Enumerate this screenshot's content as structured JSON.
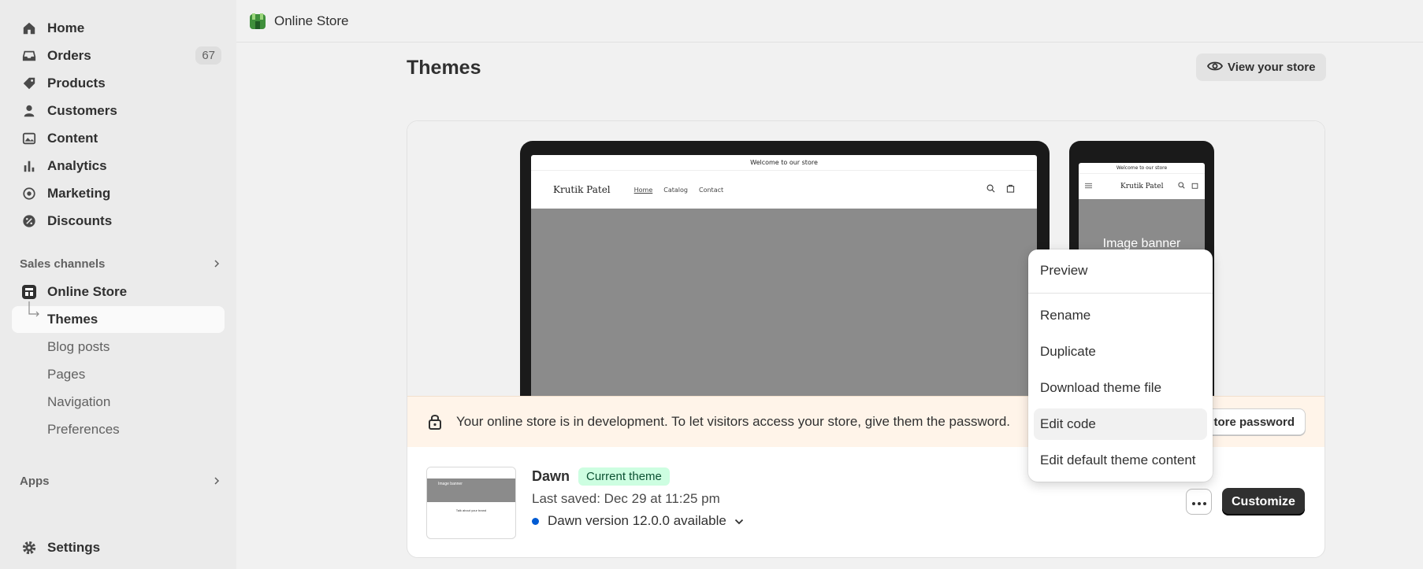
{
  "sidebar": {
    "nav": [
      {
        "label": "Home",
        "icon": "home-icon"
      },
      {
        "label": "Orders",
        "icon": "inbox-icon",
        "count": "67"
      },
      {
        "label": "Products",
        "icon": "tag-icon"
      },
      {
        "label": "Customers",
        "icon": "person-icon"
      },
      {
        "label": "Content",
        "icon": "image-icon"
      },
      {
        "label": "Analytics",
        "icon": "bar-chart-icon"
      },
      {
        "label": "Marketing",
        "icon": "target-icon"
      },
      {
        "label": "Discounts",
        "icon": "discount-icon"
      }
    ],
    "sales_channels": "Sales channels",
    "online_store": "Online Store",
    "sub_items": [
      "Themes",
      "Blog posts",
      "Pages",
      "Navigation",
      "Preferences"
    ],
    "apps": "Apps",
    "settings": "Settings"
  },
  "topbar": {
    "title": "Online Store"
  },
  "page": {
    "title": "Themes",
    "view_store": "View your store"
  },
  "preview": {
    "announcement": "Welcome to our store",
    "store_name": "Krutik Patel",
    "nav": [
      "Home",
      "Catalog",
      "Contact"
    ],
    "mobile_banner": "Image banner"
  },
  "dev_banner": {
    "message": "Your online store is in development. To let visitors access your store, give them the password.",
    "button": "tore password"
  },
  "theme": {
    "name": "Dawn",
    "badge": "Current theme",
    "last_saved": "Last saved: Dec 29 at 11:25 pm",
    "version": "Dawn version 12.0.0 available",
    "customize": "Customize",
    "thumb_banner": "Image banner",
    "thumb_text": "Talk about your brand"
  },
  "menu": {
    "preview": "Preview",
    "items": [
      "Rename",
      "Duplicate",
      "Download theme file",
      "Edit code",
      "Edit default theme content"
    ],
    "highlighted": "Edit code"
  },
  "colors": {
    "accent_blue": "#005bd3",
    "badge_bg": "#cdfee1",
    "dev_banner_bg": "#fff4e9"
  }
}
